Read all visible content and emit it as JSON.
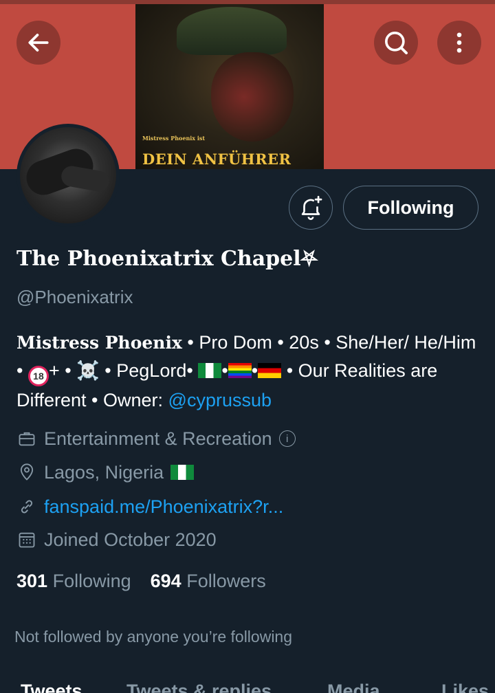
{
  "banner": {
    "poster_small_text": "Mistress Phoenix ist",
    "poster_big_text": "DEIN ANFÜHRER"
  },
  "header": {
    "back_icon": "arrow-left-icon",
    "search_icon": "search-icon",
    "more_icon": "more-vertical-icon"
  },
  "profile": {
    "name": "The Phoenixatrix Chapel⛧",
    "handle": "@Phoenixatrix",
    "follow_button_label": "Following",
    "notifications_icon": "bell-plus-icon",
    "bio": {
      "name_part": "Mistress Phoenix",
      "text_1": " • Pro Dom • 20s • She/Her/ He/Him • ",
      "age_badge": "18",
      "text_2": "+ • ☠️ • PegLord• ",
      "text_3": " • Our Realities are Different • Owner: ",
      "owner_link": "@cyprussub"
    },
    "category": "Entertainment & Recreation",
    "location": "Lagos, Nigeria",
    "website": "fanspaid.me/Phoenixatrix?r...",
    "joined": "Joined October 2020",
    "following_count": "301",
    "following_label": "Following",
    "followers_count": "694",
    "followers_label": "Followers",
    "not_followed_text": "Not followed by anyone you’re following"
  },
  "tabs": [
    "Tweets",
    "Tweets & replies",
    "Media",
    "Likes"
  ],
  "colors": {
    "background": "#15202b",
    "accent": "#1da1f2",
    "secondary_text": "#8899a6",
    "banner": "#c04a40"
  }
}
